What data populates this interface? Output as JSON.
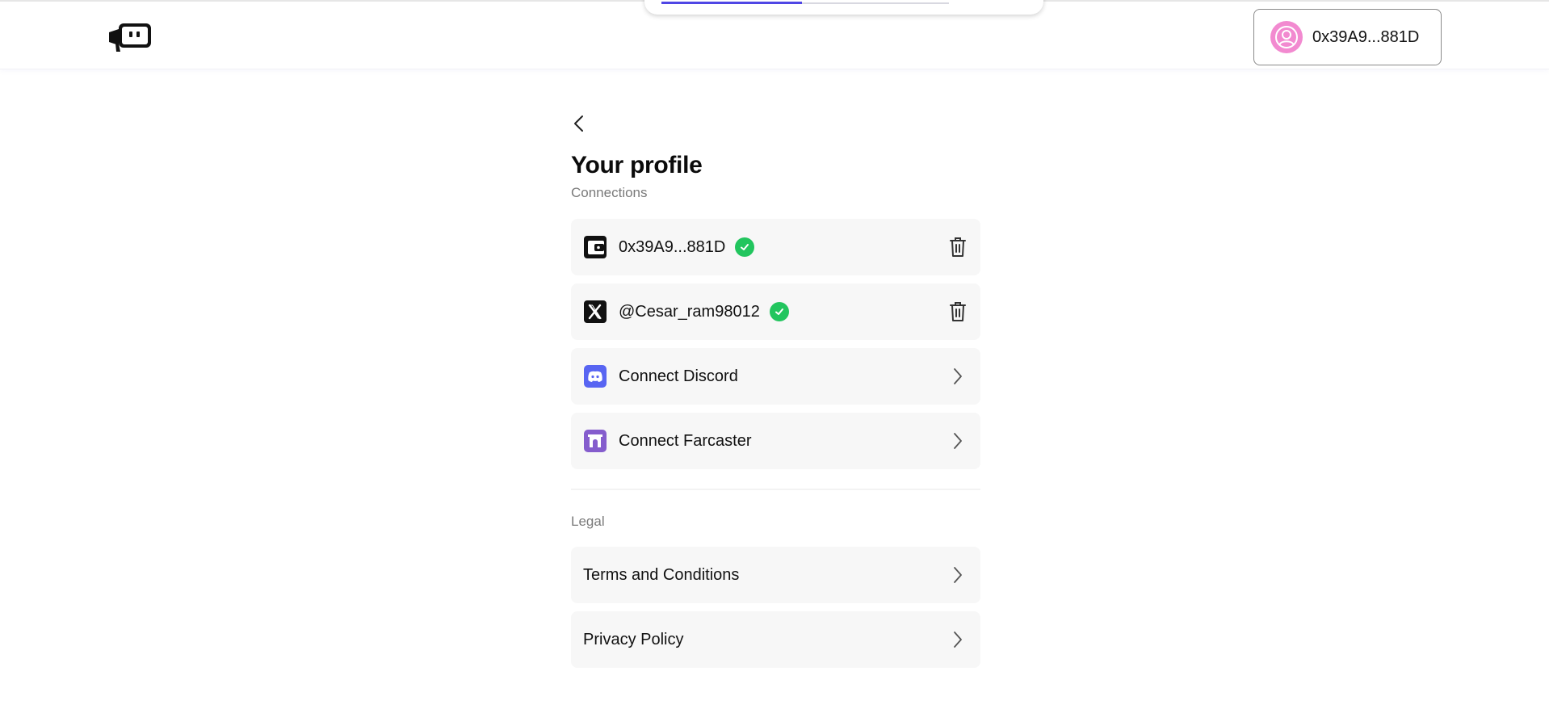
{
  "header": {
    "logo": "megaphone-logo-icon",
    "progress_percent": 49,
    "wallet_address": "0x39A9...881D",
    "avatar_icon": "user-avatar-icon"
  },
  "profile": {
    "back_icon": "chevron-left-icon",
    "title": "Your profile",
    "connections_label": "Connections",
    "connections": [
      {
        "icon": "wallet-icon",
        "label": "0x39A9...881D",
        "verified": true,
        "action_icon": "trash-icon"
      },
      {
        "icon": "x-logo-icon",
        "label": "@Cesar_ram98012",
        "verified": true,
        "action_icon": "trash-icon"
      },
      {
        "icon": "discord-icon",
        "label": "Connect Discord",
        "verified": false,
        "action_icon": "chevron-right-icon"
      },
      {
        "icon": "farcaster-icon",
        "label": "Connect Farcaster",
        "verified": false,
        "action_icon": "chevron-right-icon"
      }
    ],
    "legal_label": "Legal",
    "legal": [
      {
        "label": "Terms and Conditions",
        "action_icon": "chevron-right-icon"
      },
      {
        "label": "Privacy Policy",
        "action_icon": "chevron-right-icon"
      }
    ]
  },
  "colors": {
    "accent": "#4f46e5",
    "verified": "#22c55e",
    "discord": "#5865f2",
    "farcaster": "#855dcd",
    "avatar": "#f28ad0",
    "row_bg": "#f7f7f7"
  }
}
